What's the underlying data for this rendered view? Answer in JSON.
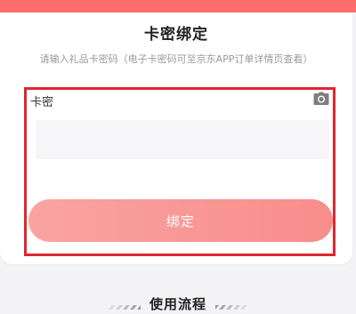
{
  "header": {
    "accent_color": "#ff6d6d"
  },
  "card": {
    "title": "卡密绑定",
    "subtitle": "请输入礼品卡密码（电子卡密码可至京东APP订单详情页查看）",
    "field_label": "卡密",
    "input_value": "",
    "input_placeholder": "",
    "camera_icon": "camera-icon",
    "bind_button_label": "绑定",
    "button_gradient": [
      "#f9a4a1",
      "#f78d8b"
    ]
  },
  "annotation": {
    "highlight_color": "#e0262e"
  },
  "section": {
    "title": "使用流程"
  }
}
